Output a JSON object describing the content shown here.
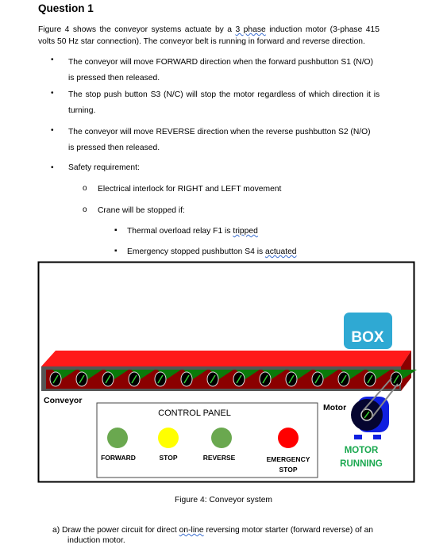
{
  "heading": "Question 1",
  "intro": {
    "part1": "Figure 4 shows the conveyor systems actuate by a ",
    "link": "3 phase",
    "part2": " induction motor (3-phase 415",
    "line2": "volts 50 Hz star connection). The conveyor belt is running in forward and reverse direction."
  },
  "bullets": [
    {
      "l1": "The conveyor will move FORWARD direction when the forward pushbutton S1 (N/O)",
      "l2": "is pressed then released."
    },
    {
      "l1": "The stop push button S3 (N/C) will stop the motor regardless of which direction it is",
      "l2": "turning."
    },
    {
      "l1": "The conveyor will move REVERSE direction when the reverse pushbutton S2 (N/O)",
      "l2": "is pressed then released."
    },
    {
      "l1": "Safety requirement:"
    }
  ],
  "sub_bullets": [
    "Electrical interlock for RIGHT and LEFT movement",
    "Crane will be stopped if:"
  ],
  "sub_sub_bullets": [
    {
      "pre": "Thermal overload relay F1 is ",
      "u": "tripped"
    },
    {
      "pre": "Emergency stopped pushbutton S4 is ",
      "u": "actuated"
    }
  ],
  "figure": {
    "box_label": "BOX",
    "conveyor_label": "Conveyor",
    "motor_label": "Motor",
    "panel_title": "CONTROL PANEL",
    "buttons": [
      {
        "label": "FORWARD",
        "color": "#6aa84f"
      },
      {
        "label": "STOP",
        "color": "#ffff00"
      },
      {
        "label": "REVERSE",
        "color": "#6aa84f"
      },
      {
        "label": "EMERGENCY",
        "label2": "STOP",
        "color": "#ff0000"
      }
    ],
    "status": {
      "l1": "MOTOR",
      "l2": "RUNNING",
      "color": "#1aa84f"
    },
    "caption": "Figure 4: Conveyor system"
  },
  "question_a": {
    "pre": "a)  Draw the power circuit for direct ",
    "u": "on-line",
    "post": " reversing motor starter (forward reverse) of an",
    "line2": "induction motor."
  }
}
